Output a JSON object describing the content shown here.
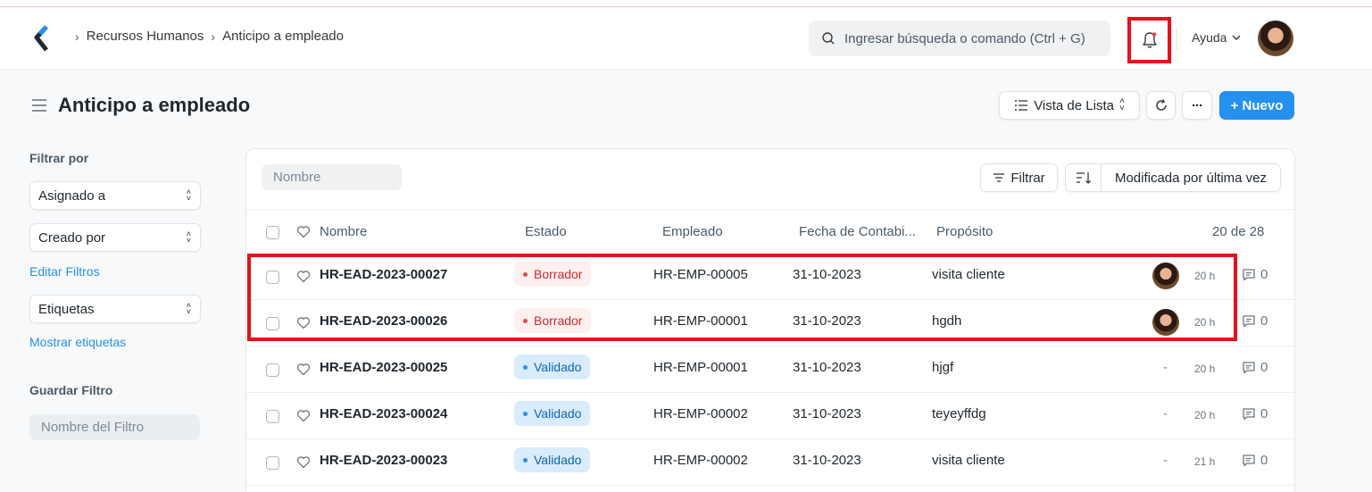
{
  "navbar": {
    "breadcrumbs": [
      "Recursos Humanos",
      "Anticipo a empleado"
    ],
    "search_placeholder": "Ingresar búsqueda o comando (Ctrl + G)",
    "help_label": "Ayuda"
  },
  "page": {
    "title": "Anticipo a empleado",
    "view_label": "Vista de Lista",
    "more_label": "···",
    "new_label": "+ Nuevo"
  },
  "sidebar": {
    "filter_by": "Filtrar por",
    "assigned_to": "Asignado a",
    "created_by": "Creado por",
    "edit_filters": "Editar Filtros",
    "tags": "Etiquetas",
    "show_tags": "Mostrar etiquetas",
    "save_filter": "Guardar Filtro",
    "filter_name_placeholder": "Nombre del Filtro"
  },
  "list": {
    "name_filter_placeholder": "Nombre",
    "filter_label": "Filtrar",
    "sort_label": "Modificada por última vez",
    "columns": [
      "Nombre",
      "Estado",
      "Empleado",
      "Fecha de Contabi...",
      "Propósito"
    ],
    "count": "20 de 28",
    "rows": [
      {
        "name": "HR-EAD-2023-00027",
        "status": "Borrador",
        "employee": "HR-EMP-00005",
        "date": "31-10-2023",
        "purpose": "visita cliente",
        "assigned": "avatar",
        "time": "20 h",
        "comments": "0"
      },
      {
        "name": "HR-EAD-2023-00026",
        "status": "Borrador",
        "employee": "HR-EMP-00001",
        "date": "31-10-2023",
        "purpose": "hgdh",
        "assigned": "avatar",
        "time": "20 h",
        "comments": "0"
      },
      {
        "name": "HR-EAD-2023-00025",
        "status": "Validado",
        "employee": "HR-EMP-00001",
        "date": "31-10-2023",
        "purpose": "hjgf",
        "assigned": "-",
        "time": "20 h",
        "comments": "0"
      },
      {
        "name": "HR-EAD-2023-00024",
        "status": "Validado",
        "employee": "HR-EMP-00002",
        "date": "31-10-2023",
        "purpose": "teyeyffdg",
        "assigned": "-",
        "time": "20 h",
        "comments": "0"
      },
      {
        "name": "HR-EAD-2023-00023",
        "status": "Validado",
        "employee": "HR-EMP-00002",
        "date": "31-10-2023",
        "purpose": "visita cliente",
        "assigned": "-",
        "time": "21 h",
        "comments": "0"
      }
    ]
  },
  "colors": {
    "accent": "#2490ef",
    "highlight": "#e8101a",
    "draft_text": "#cc2929",
    "draft_bg": "#fff0f0",
    "validated_text": "#0b65b8",
    "validated_bg": "#d8ecfd"
  }
}
